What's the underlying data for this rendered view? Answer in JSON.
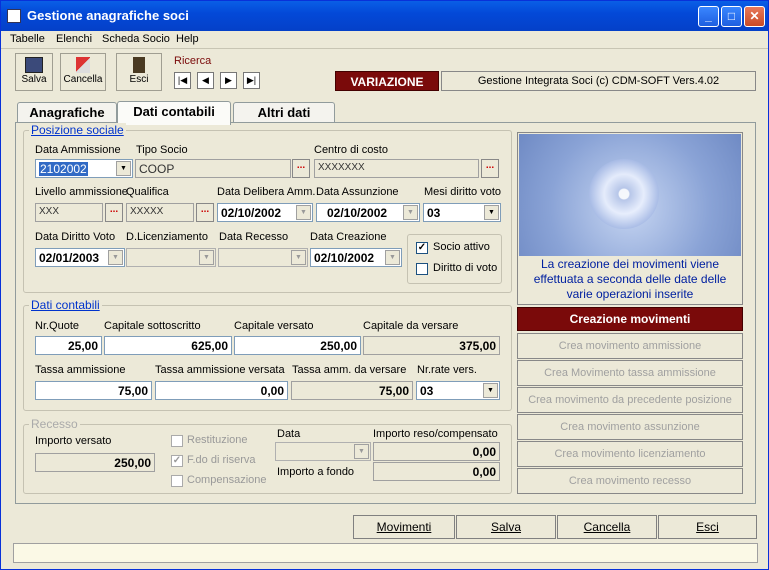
{
  "window": {
    "title": "Gestione anagrafiche soci"
  },
  "menu": [
    "Tabelle",
    "Elenchi",
    "Scheda Socio",
    "Help"
  ],
  "toolbar": {
    "save": "Salva",
    "delete": "Cancella",
    "exit": "Esci",
    "search": "Ricerca"
  },
  "status": {
    "mode": "VARIAZIONE",
    "product": "Gestione Integrata Soci (c) CDM-SOFT Vers.4.02"
  },
  "tabs": [
    "Anagrafiche",
    "Dati contabili",
    "Altri dati"
  ],
  "posizione": {
    "title": "Posizione sociale",
    "data_ammissione": {
      "label": "Data Ammissione",
      "value": "2102002"
    },
    "tipo_socio": {
      "label": "Tipo Socio",
      "value": "COOP"
    },
    "centro_costo": {
      "label": "Centro di costo",
      "value": "XXXXXXX"
    },
    "livello": {
      "label": "Livello ammissione",
      "value": "XXX"
    },
    "qualifica": {
      "label": "Qualifica",
      "value": "XXXXX"
    },
    "data_delibera": {
      "label": "Data Delibera Amm.",
      "value": "02/10/2002"
    },
    "data_assunzione": {
      "label": "Data Assunzione",
      "value": "02/10/2002"
    },
    "mesi_voto": {
      "label": "Mesi diritto voto",
      "value": "03"
    },
    "data_diritto_voto": {
      "label": "Data Diritto Voto",
      "value": "02/01/2003"
    },
    "d_licenziamento": {
      "label": "D.Licenziamento",
      "value": ""
    },
    "data_recesso": {
      "label": "Data Recesso",
      "value": ""
    },
    "data_creazione": {
      "label": "Data Creazione",
      "value": "02/10/2002"
    },
    "socio_attivo": {
      "label": "Socio attivo",
      "checked": true
    },
    "diritto_voto": {
      "label": "Diritto di voto",
      "checked": false
    }
  },
  "contabili": {
    "title": "Dati contabili",
    "nr_quote": {
      "label": "Nr.Quote",
      "value": "25,00"
    },
    "cap_sottoscritto": {
      "label": "Capitale sottoscritto",
      "value": "625,00"
    },
    "cap_versato": {
      "label": "Capitale versato",
      "value": "250,00"
    },
    "cap_da_versare": {
      "label": "Capitale da versare",
      "value": "375,00"
    },
    "tassa": {
      "label": "Tassa ammissione",
      "value": "75,00"
    },
    "tassa_versata": {
      "label": "Tassa ammissione versata",
      "value": "0,00"
    },
    "tassa_da_versare": {
      "label": "Tassa amm. da versare",
      "value": "75,00"
    },
    "nr_rate": {
      "label": "Nr.rate vers.",
      "value": "03"
    }
  },
  "recesso": {
    "title": "Recesso",
    "importo_versato": {
      "label": "Importo versato",
      "value": "250,00"
    },
    "restituzione": "Restituzione",
    "fdo_riserva": "F.do di riserva",
    "compensazione": "Compensazione",
    "data_label": "Data",
    "importo_reso": {
      "label": "Importo reso/compensato",
      "value": "0,00"
    },
    "importo_fondo": {
      "label": "Importo a fondo",
      "value": "0,00"
    }
  },
  "info_text": "La creazione dei movimenti viene effettuata a seconda delle date delle varie operazioni inserite",
  "side_buttons": {
    "header": "Creazione movimenti",
    "items": [
      "Crea movimento ammissione",
      "Crea Movimento tassa ammissione",
      "Crea movimento da precedente posizione",
      "Crea movimento assunzione",
      "Crea movimento licenziamento",
      "Crea movimento recesso"
    ]
  },
  "bottom_buttons": [
    "Movimenti",
    "Salva",
    "Cancella",
    "Esci"
  ],
  "colors": {
    "accent": "#7a0a0a",
    "title": "#0349d8"
  }
}
